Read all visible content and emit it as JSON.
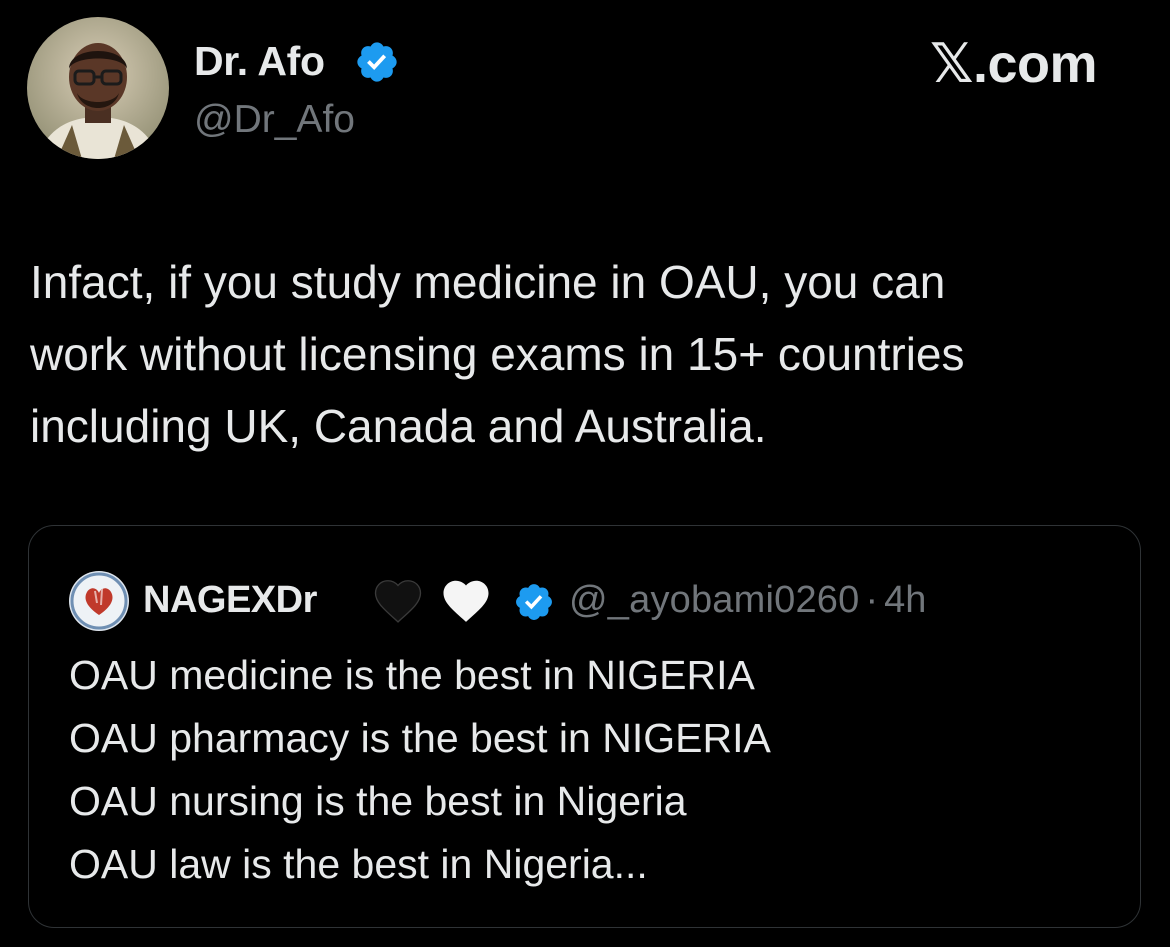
{
  "tweet": {
    "author": {
      "name": "Dr. Afo",
      "handle": "@Dr_Afo",
      "verified": true,
      "avatar_icon": "profile-photo"
    },
    "brand": "𝕏.com",
    "text": "Infact, if you study medicine in OAU, you can\nwork without licensing exams in 15+ countries\nincluding UK, Canada and Australia.",
    "quoted": {
      "name": "NAGEXDr",
      "name_emojis": [
        "black-heart-icon",
        "white-heart-icon"
      ],
      "verified": true,
      "handle": "@_ayobami0260",
      "separator": "·",
      "time": "4h",
      "lines": [
        "OAU medicine is the best in NIGERIA",
        "OAU pharmacy is the best in NIGERIA",
        "OAU nursing is the best in Nigeria",
        "OAU law is the best in Nigeria..."
      ]
    }
  },
  "colors": {
    "background": "#000000",
    "text_primary": "#e7e9ea",
    "text_secondary": "#71767b",
    "verified_blue": "#1d9bf0",
    "card_border": "#2f3336"
  }
}
